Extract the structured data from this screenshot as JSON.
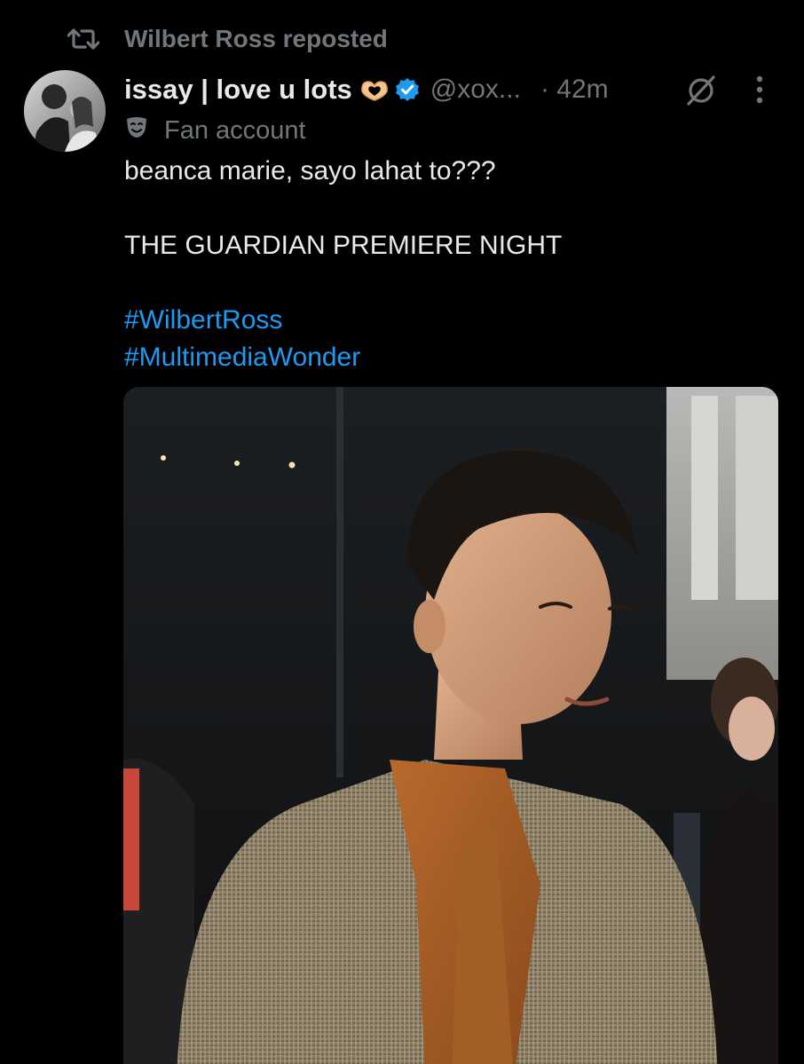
{
  "repost": {
    "text": "Wilbert Ross reposted"
  },
  "tweet": {
    "display_name": "issay | love u lots",
    "handle": "@xox...",
    "time": "· 42m",
    "label": "Fan account",
    "lines": [
      "beanca marie, sayo lahat to???",
      "",
      "THE GUARDIAN PREMIERE NIGHT",
      ""
    ],
    "hashtags": [
      "#WilbertRoss",
      "#MultimediaWonder"
    ]
  },
  "colors": {
    "background": "#000000",
    "text_primary": "#e7e9ea",
    "text_secondary": "#71767b",
    "link": "#1d9bf0",
    "verified": "#1d9bf0"
  },
  "icons": {
    "repost": "repost-icon",
    "heart_hands": "heart-hands-icon",
    "verified": "verified-badge-icon",
    "grok": "grok-icon",
    "more": "more-vertical-icon",
    "fan_account": "theater-masks-icon"
  }
}
